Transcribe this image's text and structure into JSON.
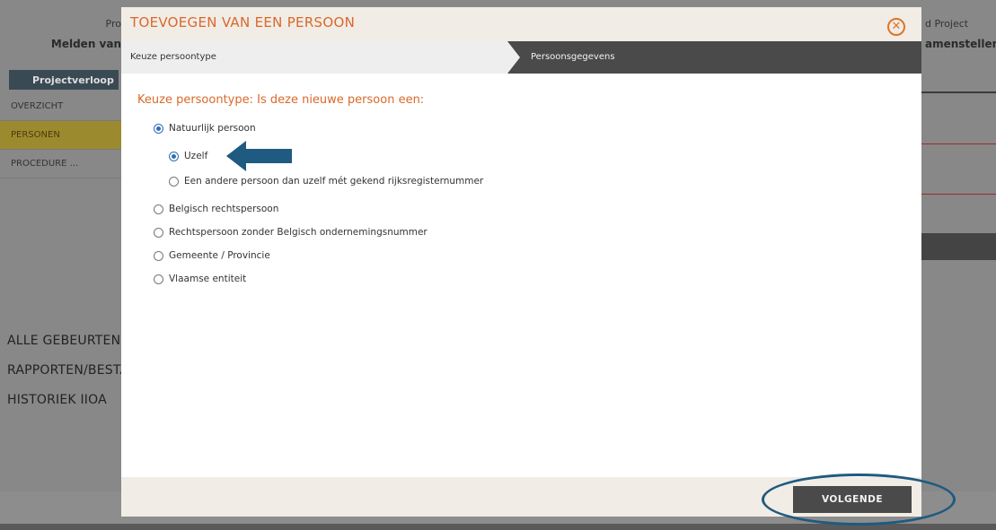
{
  "background": {
    "top_left_1": "Pro",
    "top_left_2": "Melden van",
    "tab": "Projectverloop",
    "nav": [
      "OVERZICHT",
      "PERSONEN",
      "PROCEDURE ..."
    ],
    "links": [
      "ALLE GEBEURTENIS",
      "RAPPORTEN/BESTA",
      "HISTORIEK IIOA"
    ],
    "top_right_1": "d Project",
    "top_right_2": "amenstellen"
  },
  "modal": {
    "title": "TOEVOEGEN VAN EEN PERSOON",
    "steps": [
      "Keuze persoontype",
      "Persoonsgegevens"
    ],
    "question": "Keuze persoontype: Is deze nieuwe persoon een:",
    "options": {
      "natural": "Natuurlijk persoon",
      "self": "Uzelf",
      "other": "Een andere persoon dan uzelf mét gekend rijksregisternummer",
      "belgian_legal": "Belgisch rechtspersoon",
      "legal_no_number": "Rechtspersoon zonder Belgisch ondernemingsnummer",
      "municipality": "Gemeente / Provincie",
      "flemish": "Vlaamse entiteit"
    },
    "next_label": "VOLGENDE"
  },
  "colors": {
    "accent_orange": "#d9692a",
    "annotation_blue": "#1f5a80",
    "radio_blue": "#2d6fb5"
  }
}
